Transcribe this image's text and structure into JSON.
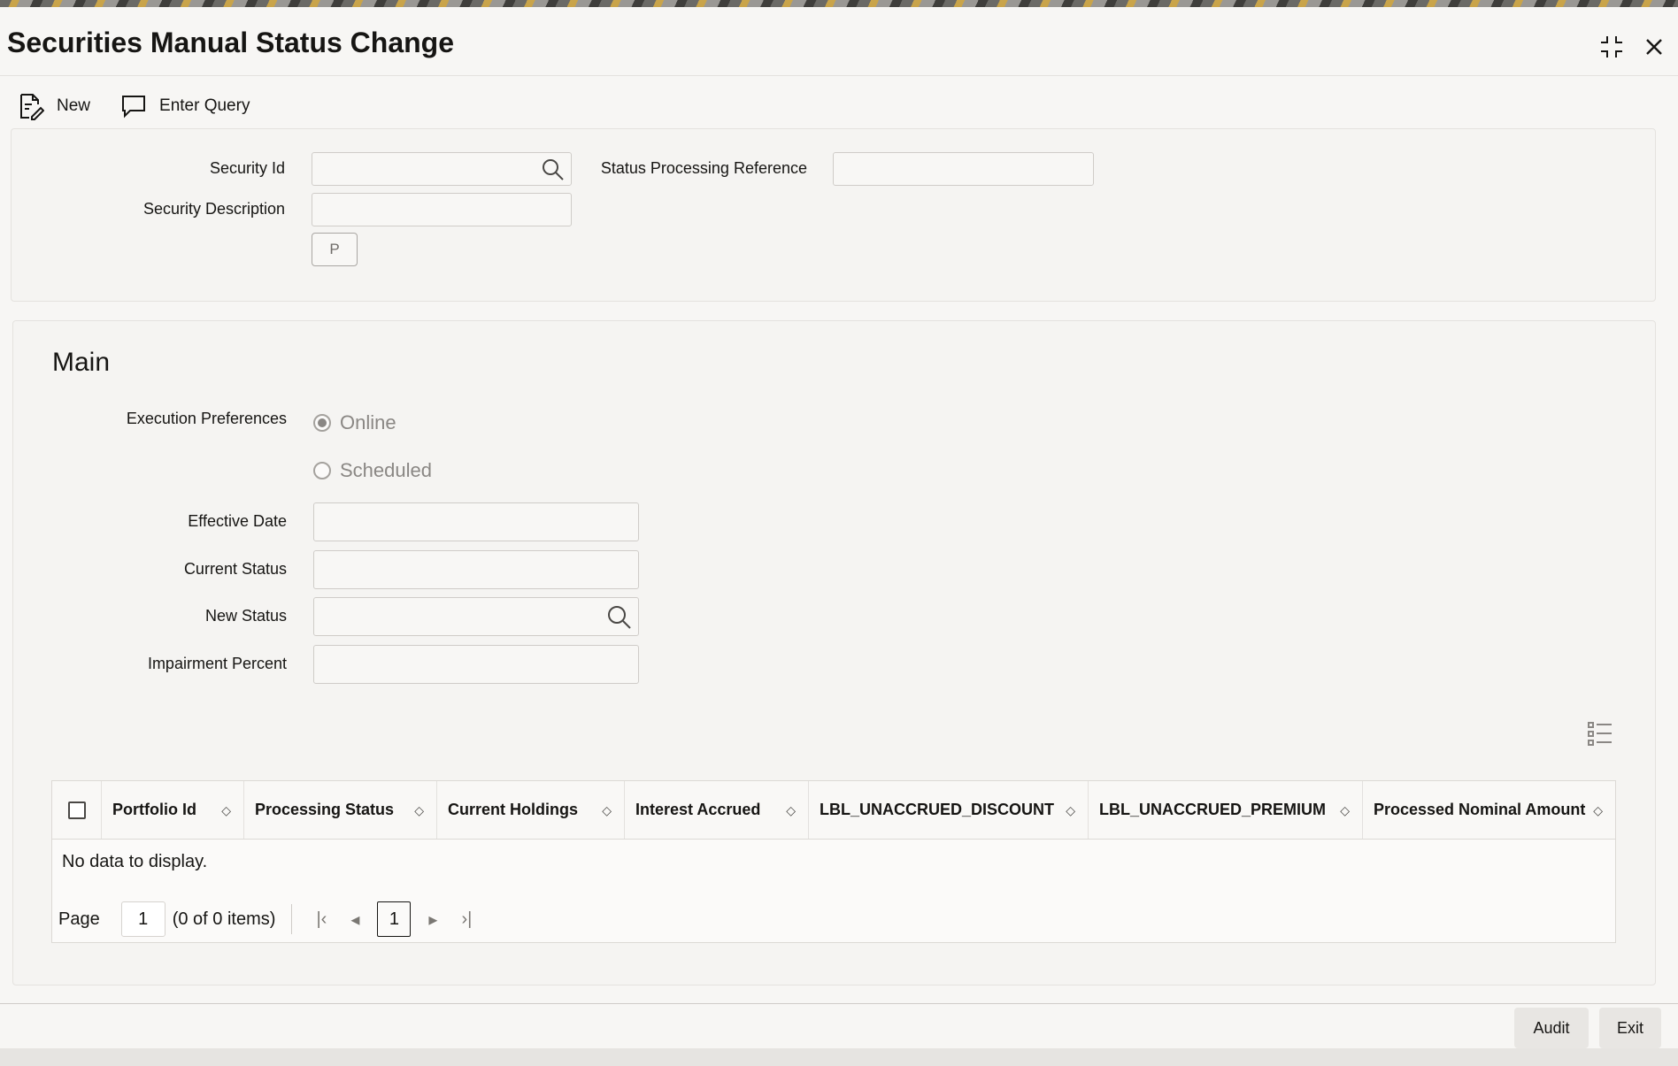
{
  "window": {
    "title": "Securities Manual Status Change",
    "minimize_icon": "collapse-icon",
    "close_icon": "close-icon"
  },
  "toolbar": {
    "new_label": "New",
    "enter_query_label": "Enter Query"
  },
  "header_form": {
    "security_id_label": "Security Id",
    "security_id_value": "",
    "security_description_label": "Security Description",
    "security_description_value": "",
    "status_processing_reference_label": "Status Processing Reference",
    "status_processing_reference_value": "",
    "p_button_label": "P"
  },
  "main": {
    "section_title": "Main",
    "execution_preferences_label": "Execution Preferences",
    "execution_options": [
      {
        "label": "Online",
        "selected": true
      },
      {
        "label": "Scheduled",
        "selected": false
      }
    ],
    "effective_date_label": "Effective Date",
    "effective_date_value": "",
    "current_status_label": "Current Status",
    "current_status_value": "",
    "new_status_label": "New Status",
    "new_status_value": "",
    "impairment_percent_label": "Impairment Percent",
    "impairment_percent_value": ""
  },
  "table": {
    "columns": [
      "Portfolio Id",
      "Processing Status",
      "Current Holdings",
      "Interest Accrued",
      "LBL_UNACCRUED_DISCOUNT",
      "LBL_UNACCRUED_PREMIUM",
      "Processed Nominal Amount"
    ],
    "rows": [],
    "empty_message": "No data to display.",
    "pager": {
      "page_label": "Page",
      "page_value": "1",
      "items_summary": "(0 of 0 items)",
      "current_page": "1"
    }
  },
  "footer": {
    "audit_label": "Audit",
    "exit_label": "Exit"
  }
}
